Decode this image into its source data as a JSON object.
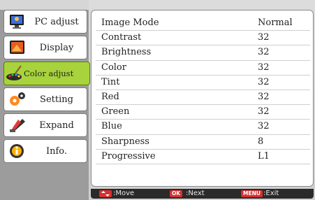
{
  "sidebar": {
    "items": [
      {
        "label": "PC adjust",
        "icon": "monitor-icon"
      },
      {
        "label": "Display",
        "icon": "display-icon"
      },
      {
        "label": "Color adjust",
        "icon": "palette-icon"
      },
      {
        "label": "Setting",
        "icon": "gears-icon"
      },
      {
        "label": "Expand",
        "icon": "expand-icon"
      },
      {
        "label": "Info.",
        "icon": "info-icon"
      }
    ],
    "active_index": 2
  },
  "settings": [
    {
      "name": "Image Mode",
      "value": "Normal"
    },
    {
      "name": "Contrast",
      "value": "32"
    },
    {
      "name": "Brightness",
      "value": "32"
    },
    {
      "name": "Color",
      "value": "32"
    },
    {
      "name": "Tint",
      "value": "32"
    },
    {
      "name": "Red",
      "value": "32"
    },
    {
      "name": "Green",
      "value": "32"
    },
    {
      "name": "Blue",
      "value": "32"
    },
    {
      "name": "Sharpness",
      "value": "8"
    },
    {
      "name": "Progressive",
      "value": "L1"
    }
  ],
  "footer": {
    "move_label": ":Move",
    "ok_key": "OK",
    "next_label": ":Next",
    "menu_key": "MENU",
    "exit_label": ":Exit"
  },
  "colors": {
    "active_item": "#a8d33c",
    "footer_key": "#d63030"
  }
}
